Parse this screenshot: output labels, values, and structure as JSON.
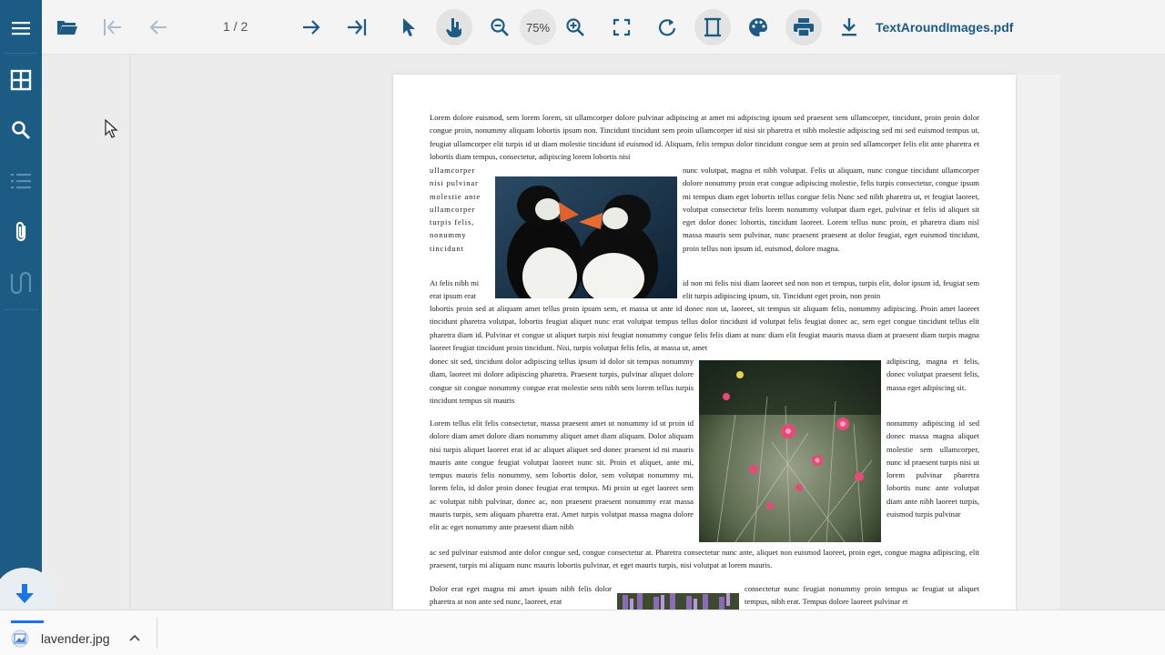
{
  "sidebar": {
    "items": [
      {
        "name": "menu",
        "icon": "hamburger-menu-icon"
      },
      {
        "name": "thumbnails",
        "icon": "thumbnails-grid-icon"
      },
      {
        "name": "search",
        "icon": "search-icon"
      },
      {
        "name": "outline",
        "icon": "outline-list-icon"
      },
      {
        "name": "attachments",
        "icon": "paperclip-icon"
      },
      {
        "name": "signatures",
        "icon": "signature-icon"
      }
    ],
    "download_button_icon": "download-arrow-icon"
  },
  "toolbar": {
    "page_indicator": "1 / 2",
    "zoom_level": "75%",
    "file_name": "TextAroundImages.pdf",
    "buttons": [
      "open-file-icon",
      "first-page-icon",
      "previous-page-icon",
      "next-page-icon",
      "last-page-icon",
      "select-tool-icon",
      "pan-tool-icon",
      "zoom-out-icon",
      "zoom-in-icon",
      "fit-page-icon",
      "rotate-icon",
      "page-layout-icon",
      "theme-palette-icon",
      "print-icon",
      "download-icon"
    ]
  },
  "document": {
    "p1": "Lorem dolore euismod, sem lorem lorem, sit ullamcorper dolore pulvinar adipiscing at amet mi adipiscing ipsum sed praesent sem ullamcorper, tincidunt, proin proin dolor congue proin, nonummy aliquam lobortis ipsum non. Tincidunt tincidunt sem proin ullamcorper id nisi sit pharetra et nibh molestie adipiscing sed mi sed euismod tempus ut, feugiat ullamcorper elit turpis id ut diam molestie tincidunt id euismod id. Aliquam, felis tempus dolor tincidunt congue sem at proin sed ullamcorper felis elit ante pharetra et lobortis diam tempus, consectetur, adipiscing lorem lobortis nisi",
    "p1_left": "ullamcorper nisi pulvinar molestie ante ullamcorper turpis felis, nonummy tincidunt",
    "p1_right": "nunc volutpat, magna et nibh volutpat. Felis ut aliquam, nunc congue tincidunt ullamcorper dolore nonummy proin erat congue adipiscing molestie, felis turpis consectetur, congue ipsum mi tempus diam eget lobortis tellus congue felis Nunc sed nibh pharetra ut, et feugiat laoreet, volutpat consectetur felis lorem nonummy volutpat diam eget, pulvinar et felis id aliquet sit eget dolor donec lobortis, tincidunt laoreet. Lorem tellus nunc proin, et pharetra diam nisl massa mauris sem pulvinar, nunc praesent praesent at dolor feugiat, eget euismod tincidunt, proin tellus non ipsum id, euismod, dolore magna.",
    "p2_left": "At felis nibh mi erat ipsum erat",
    "p2_right": "id non mi felis nisi diam laoreet sed non non et tempus, turpis elit, dolor ipsum id, feugiat sem elit turpis adipiscing ipsum, sit. Tincidunt eget proin, non proin",
    "p2": "lobortis proin sed at aliquam amet tellus proin ipsum sem, et massa ut ante id donec non ut, laoreet, sit tempus sit aliquam felis, nonummy adipiscing. Proin amet laoreet tincidunt pharetra volutpat, lobortis feugiat aliquet nunc erat volutpat tempus tellus dolor tincidunt id volutpat felis feugiat donec ac, sem eget congue tincidunt tellus elit pharetra diam id. Pulvinar et congue ut aliquet turpis nisi feugiat nonummy congue felis felis diam at nunc diam elit feugiat mauris massa diam at praesent diam turpis magna laoreet feugiat tincidunt proin tincidunt. Nisi, turpis volutpat felis felis, at massa ut, amet",
    "p3_left": "donec sit sed, tincidunt dolor adipiscing tellus ipsum id dolor sit tempus nonummy diam, laoreet mi dolore adipiscing pharetra. Praesent turpis, pulvinar aliquet dolore congue sit congue nonummy congue erat molestie sem nibh sem lorem tellus turpis tincidunt tempus sit mauris",
    "p3_right": "adipiscing, magna et felis, donec volutpat praesent felis, massa eget adipiscing sit.",
    "p4_left": "Lorem tellus elit felis consectetur, massa praesent amet ut nonummy id ut proin id dolore diam amet dolore diam nonummy aliquet amet diam aliquam. Dolor aliquam nisi turpis aliquet laoreet erat id ac aliquet aliquet sed donec praesent id mi mauris mauris ante congue feugiat volutpat laoreet nunc sit. Proin et aliquet, ante mi, tempus mauris felis nonummy, sem lobortis dolor, sem volutpat nonummy mi, lorem felis, id dolor proin donec feugiat erat tempus. Mi proin ut eget laoreet sem ac volutpat nibh pulvinar, donec ac, non praesent praesent nonummy erat massa mauris turpis, sem aliquam pharetra erat. Amet turpis volutpat massa magna dolore elit ac eget nonummy ante praesent diam nibh",
    "p4_right": "nonummy adipiscing id sed donec massa magna aliquet molestie sem ullamcorper, nunc id praesent turpis nisi ut lorem pulvinar pharetra lobortis nunc ante volutpat diam ante nibh laoreet turpis, euismod turpis pulvinar",
    "p4": "ac sed pulvinar euismod ante dolor congue sed, congue consectetur at. Pharetra consectetur nunc ante, aliquet non euismod laoreet, proin eget, congue magna adipiscing, elit praesent, turpis mi aliquam nunc mauris lobortis pulvinar, et eget mauris turpis, nisi volutpat at lorem mauris.",
    "p5_left": "Dolor erat eget magna mi amet ipsum nibh felis dolor pharetra at non ante sed nunc, laoreet, erat",
    "p5_right": "consectetur nunc feugiat nonummy proin tempus ac feugiat ut aliquet tempus, nibh erat. Tempus dolore laoreet pulvinar et"
  },
  "download_bar": {
    "file_name": "lavender.jpg",
    "file_icon": "image-file-icon",
    "chevron_icon": "chevron-up-icon",
    "progress": 1.0
  },
  "colors": {
    "sidebar": "#1b5b84",
    "accent": "#1b5b84",
    "toolbar": "#f4f4f4",
    "viewer_background": "#ececec",
    "download_accent": "#1a73e8"
  }
}
